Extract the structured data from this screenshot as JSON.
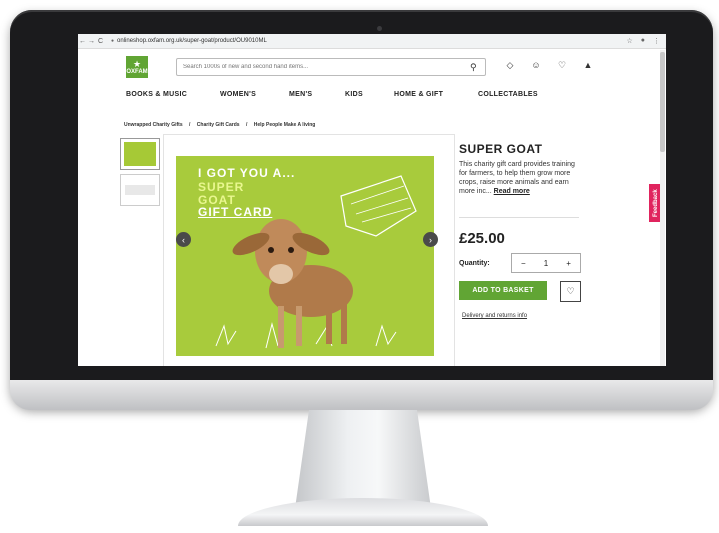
{
  "browser": {
    "url": "onlineshop.oxfam.org.uk/super-goat/product/OU9010ML",
    "back": "←",
    "forward": "→",
    "reload": "C",
    "star_icon": "star-icon",
    "account_icon": "account-icon",
    "menu_icon": "menu-icon"
  },
  "header": {
    "logo_text": "OXFAM",
    "search_placeholder": "Search 1000s of new and second hand items...",
    "icons": [
      "search-icon",
      "diamond-icon",
      "user-icon",
      "heart-icon",
      "basket-icon"
    ]
  },
  "nav": {
    "items": [
      "BOOKS & MUSIC",
      "WOMEN'S",
      "MEN'S",
      "KIDS",
      "HOME & GIFT",
      "COLLECTABLES"
    ]
  },
  "breadcrumb": {
    "items": [
      "Unwrapped Charity Gifts",
      "Charity Gift Cards",
      "Help People Make A living"
    ],
    "separator": "/"
  },
  "card": {
    "line1": "I GOT YOU A...",
    "line2": "SUPER",
    "line3": "GOAT",
    "line4": "GIFT CARD"
  },
  "product": {
    "title": "SUPER GOAT",
    "description": "This charity gift card provides training for farmers, to help them grow more crops, raise more animals and earn more inc...",
    "read_more": "Read more",
    "price": "£25.00",
    "quantity_label": "Quantity:",
    "quantity_value": "1",
    "minus": "−",
    "plus": "+",
    "add_to_basket": "ADD TO BASKET",
    "delivery_link": "Delivery and returns info"
  },
  "feedback_tab": "Feedback",
  "colors": {
    "brand_green": "#61a534",
    "card_green": "#a8cb3c",
    "feedback_pink": "#e0245e"
  }
}
